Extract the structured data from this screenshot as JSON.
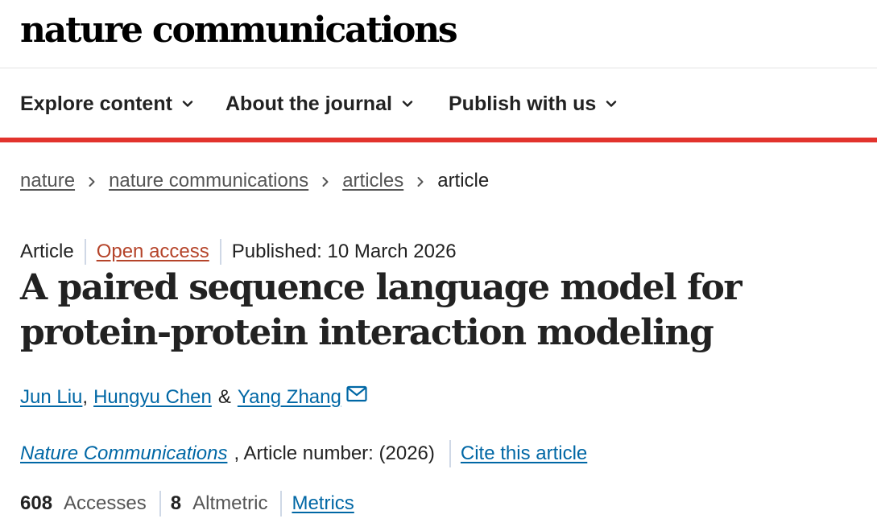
{
  "header": {
    "logo_text": "nature communications"
  },
  "nav": {
    "items": [
      {
        "label": "Explore content",
        "icon": "chevron-down-icon"
      },
      {
        "label": "About the journal",
        "icon": "chevron-down-icon"
      },
      {
        "label": "Publish with us",
        "icon": "chevron-down-icon"
      }
    ],
    "accent_color": "#e2332d"
  },
  "breadcrumb": {
    "items": [
      "nature",
      "nature communications",
      "articles"
    ],
    "current": "article"
  },
  "article_meta": {
    "type": "Article",
    "access": "Open access",
    "published": "Published: 10 March 2026"
  },
  "article": {
    "title": "A paired sequence language model for protein-protein interaction modeling"
  },
  "authors": {
    "list": [
      "Jun Liu",
      "Hungyu Chen",
      "Yang Zhang"
    ],
    "separator_1": ",",
    "separator_2": "&",
    "corresponding_icon": "mail-icon"
  },
  "journal": {
    "name": "Nature Communications",
    "article_number_text": ", Article number:  (2026)",
    "cite_label": "Cite this article"
  },
  "metrics": {
    "accesses_count": "608",
    "accesses_label": "Accesses",
    "altmetric_count": "8",
    "altmetric_label": "Altmetric",
    "metrics_link": "Metrics"
  },
  "colors": {
    "link": "#0067a5",
    "open_access": "#b5442a",
    "text": "#222222"
  }
}
